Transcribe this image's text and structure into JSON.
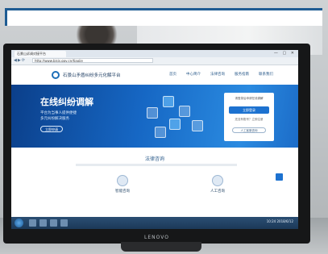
{
  "browser": {
    "tab_title": "石景山诉调对接平台",
    "url": "http://www.bjsjs.gov.cn/tiaojie"
  },
  "site": {
    "title": "石景山矛盾纠纷多元化解平台",
    "nav": [
      "首页",
      "中心简介",
      "法律咨询",
      "服务指南",
      "联系我们"
    ]
  },
  "banner": {
    "title": "在线纠纷调解",
    "subtitle_line1": "平台为当事人提供便捷",
    "subtitle_line2": "多元纠纷解决服务",
    "button": "立即申请"
  },
  "login": {
    "header": "请登录后申请在线调解",
    "primary_button": "立即登录",
    "link": "还没有账号？立即注册",
    "secondary_button": "人工客服咨询"
  },
  "section": {
    "title": "法律咨询",
    "services": [
      {
        "label": "智能咨询",
        "icon": "robot-icon"
      },
      {
        "label": "人工咨询",
        "icon": "person-icon"
      }
    ]
  },
  "monitor_brand": "LENOVO",
  "taskbar": {
    "clock": "10:24 2018/6/12"
  },
  "colors": {
    "header_bracket": "#1f5c93",
    "banner": "#1667c4",
    "primary": "#1d72d0"
  }
}
